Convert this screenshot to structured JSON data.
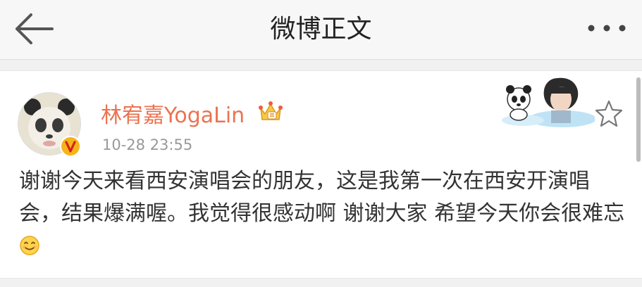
{
  "nav": {
    "title": "微博正文",
    "back_icon": "arrow-left-icon",
    "more_icon": "more-dots-icon"
  },
  "post": {
    "user_name": "林宥嘉YogaLin",
    "time": "10-28 23:55",
    "text": "谢谢今天来看西安演唱会的朋友，这是我第一次在西安开演唱会，结果爆满喔。我觉得很感动啊 谢谢大家 希望今天你会很难忘",
    "emoji_icon": "smile-icon",
    "badges": [
      "verified-v-icon",
      "crown-icon"
    ],
    "star_icon": "star-outline-icon"
  },
  "colors": {
    "username": "#eb7350",
    "verify": "#f5b41c",
    "nav_bg": "#f7f7f7",
    "page_bg": "#f1f1f1"
  }
}
